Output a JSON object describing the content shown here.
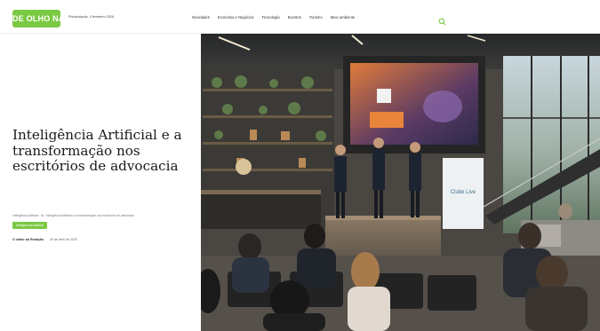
{
  "header": {
    "logo_text": "DE OLHO NA ILHA",
    "date": "Florianópolis, 3 fevereiro 2026",
    "nav": [
      "Novidades",
      "Economia e Negócios",
      "Tecnologia",
      "Eventos",
      "Turismo",
      "Meio ambiente"
    ],
    "search_icon": "search-icon"
  },
  "article": {
    "title": "Inteligência Artificial e a transformação nos escritórios de advocacia",
    "breadcrumb": "Inteligência Artificial › IA › Inteligência Artificial e a transformação nos escritórios de advocacia",
    "category": "Inteligência Artificial",
    "author": "O editor da Redação",
    "published": "30 de abril de 2025"
  },
  "hero": {
    "banner_text": "Clube Live"
  },
  "colors": {
    "brand_green": "#7ac943",
    "text_dark": "#1a1a1a"
  }
}
